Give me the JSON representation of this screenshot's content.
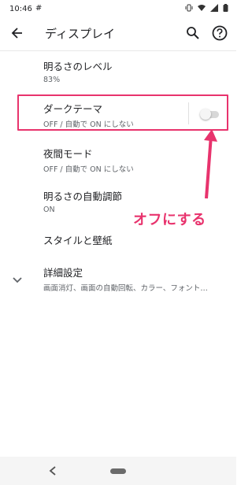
{
  "status_bar": {
    "time": "10:46",
    "slack_glyph": "#"
  },
  "app_bar": {
    "title": "ディスプレイ"
  },
  "settings": {
    "brightness": {
      "title": "明るさのレベル",
      "summary": "83%"
    },
    "dark_theme": {
      "title": "ダークテーマ",
      "summary": "OFF / 自動で ON にしない",
      "toggle_on": false
    },
    "night_mode": {
      "title": "夜間モード",
      "summary": "OFF / 自動で ON にしない"
    },
    "auto_brightness": {
      "title": "明るさの自動調節",
      "summary": "ON"
    },
    "style_wallpaper": {
      "title": "スタイルと壁紙"
    },
    "advanced": {
      "title": "詳細設定",
      "summary": "画面消灯、画面の自動回転、カラー、フォント…"
    }
  },
  "annotation": {
    "text": "オフにする",
    "color": "#e8336d"
  },
  "colors": {
    "highlight": "#e8336d",
    "text_primary": "#202124",
    "text_secondary": "#5f6368"
  },
  "icons": {
    "back": "arrow-left-icon",
    "search": "search-icon",
    "help": "help-circle-icon",
    "expand": "chevron-down-icon",
    "nav_back": "nav-back-triangle-icon",
    "nav_home": "home-pill-icon"
  }
}
